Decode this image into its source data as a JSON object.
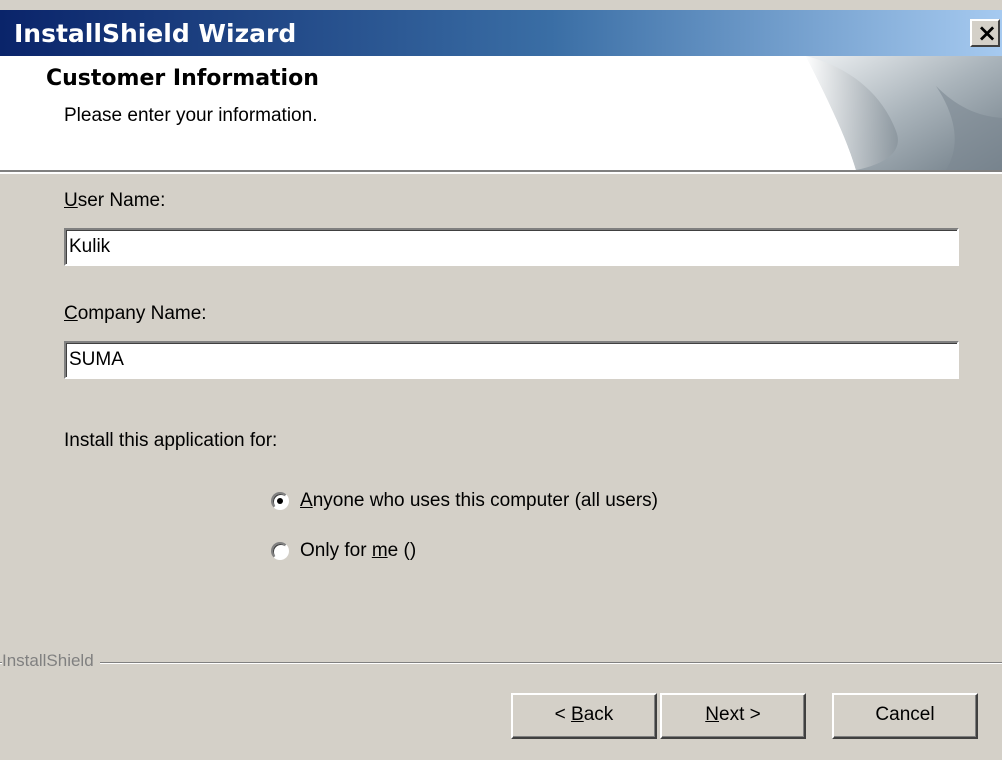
{
  "window": {
    "title": "InstallShield Wizard",
    "close_glyph": "×"
  },
  "header": {
    "title": "Customer Information",
    "subtitle": "Please enter your information."
  },
  "form": {
    "user_name": {
      "label_access_key": "U",
      "label_rest": "ser Name:",
      "value": "Kulik"
    },
    "company_name": {
      "label_access_key": "C",
      "label_rest": "ompany Name:",
      "value": "SUMA"
    },
    "install_for_label": "Install this application for:",
    "options": [
      {
        "access_key": "A",
        "rest": "nyone who uses this computer (all users)",
        "selected": true
      },
      {
        "prefix": "Only for ",
        "access_key": "m",
        "rest": "e ()",
        "selected": false
      }
    ]
  },
  "footer": {
    "brand": "InstallShield",
    "buttons": {
      "back_prefix": "< ",
      "back_key": "B",
      "back_rest": "ack",
      "next_key": "N",
      "next_rest": "ext >",
      "cancel": "Cancel"
    }
  },
  "colors": {
    "dialog_bg": "#d4d0c8",
    "title_gradient_start": "#0a246a",
    "title_gradient_end": "#a6caf0"
  }
}
